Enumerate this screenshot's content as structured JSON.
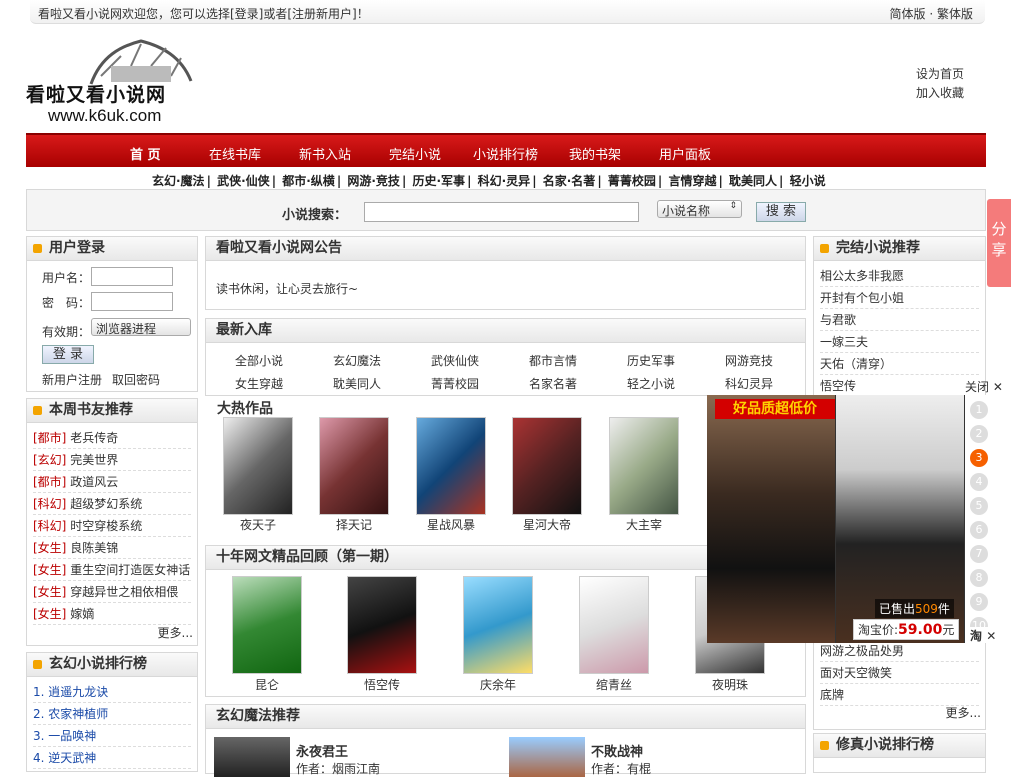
{
  "topbar": {
    "welcome": "看啦又看小说网欢迎您，您可以选择[登录]或者[注册新用户]！",
    "lang": "简体版 · 繁体版"
  },
  "logo": {
    "name": "看啦又看小说网",
    "url": "www.k6uk.com"
  },
  "toplinks": {
    "home": "设为首页",
    "fav": "加入收藏"
  },
  "nav": [
    "首 页",
    "在线书库",
    "新书入站",
    "完结小说",
    "小说排行榜",
    "我的书架",
    "用户面板"
  ],
  "subnav": [
    "玄幻·魔法",
    "武侠·仙侠",
    "都市·纵横",
    "网游·竞技",
    "历史·军事",
    "科幻·灵异",
    "名家·名著",
    "菁菁校园",
    "言情穿越",
    "耽美同人",
    "轻小说"
  ],
  "search": {
    "label": "小说搜索：",
    "select": "小说名称",
    "button": "搜 索"
  },
  "login": {
    "title": "用户登录",
    "user": "用户名：",
    "pass": "密　码：",
    "expire": "有效期：",
    "expire_value": "浏览器进程",
    "submit": "登 录",
    "register": "新用户注册",
    "forgot": "取回密码"
  },
  "weekly": {
    "title": "本周书友推荐",
    "items": [
      {
        "cat": "[都市]",
        "name": "老兵传奇"
      },
      {
        "cat": "[玄幻]",
        "name": "完美世界"
      },
      {
        "cat": "[都市]",
        "name": "政道风云"
      },
      {
        "cat": "[科幻]",
        "name": "超级梦幻系统"
      },
      {
        "cat": "[科幻]",
        "name": "时空穿梭系统"
      },
      {
        "cat": "[女生]",
        "name": "良陈美锦"
      },
      {
        "cat": "[女生]",
        "name": "重生空间打造医女神话"
      },
      {
        "cat": "[女生]",
        "name": "穿越异世之相依相偎"
      },
      {
        "cat": "[女生]",
        "name": "嫁嫡"
      }
    ],
    "more": "更多..."
  },
  "fantasy_rank": {
    "title": "玄幻小说排行榜",
    "items": [
      "1. 逍遥九龙诀",
      "2. 农家神植师",
      "3. 一品唤神",
      "4. 逆天武神"
    ]
  },
  "notice": {
    "title": "看啦又看小说网公告",
    "text": "读书休闲，让心灵去旅行~"
  },
  "newbooks": {
    "title": "最新入库",
    "cats": [
      "全部小说",
      "玄幻魔法",
      "武侠仙侠",
      "都市言情",
      "历史军事",
      "网游竞技",
      "女生穿越",
      "耽美同人",
      "菁菁校园",
      "名家名著",
      "轻之小说",
      "科幻灵异"
    ]
  },
  "hot": {
    "title": "大热作品",
    "books": [
      "夜天子",
      "择天记",
      "星战风暴",
      "星河大帝",
      "大主宰"
    ]
  },
  "ten": {
    "title": "十年网文精品回顾（第一期）",
    "books": [
      "昆仑",
      "悟空传",
      "庆余年",
      "绾青丝",
      "夜明珠"
    ]
  },
  "fantasy_rec": {
    "title": "玄幻魔法推荐",
    "books": [
      {
        "name": "永夜君王",
        "author": "作者：烟雨江南"
      },
      {
        "name": "不敗战神",
        "author": "作者：有棍"
      }
    ]
  },
  "done": {
    "title": "完结小说推荐",
    "items": [
      "相公太多非我愿",
      "开封有个包小姐",
      "与君歌",
      "一嫁三夫",
      "天佑（清穿）",
      "悟空传"
    ],
    "items2": [
      "网游之极品处男",
      "面对天空微笑",
      "底牌"
    ],
    "more": "更多..."
  },
  "xiuzhen": {
    "title": "修真小说排行榜"
  },
  "share": "分享",
  "ad": {
    "close": "关闭",
    "headline": "好品质超低价",
    "sold": "已售出",
    "sold_count": "509",
    "unit": "件",
    "price_label": "淘宝价:",
    "price": "59.00",
    "price_unit": "元",
    "tao": "淘",
    "nums": [
      "1",
      "2",
      "3",
      "4",
      "5",
      "6",
      "7",
      "8",
      "9",
      "10"
    ]
  }
}
